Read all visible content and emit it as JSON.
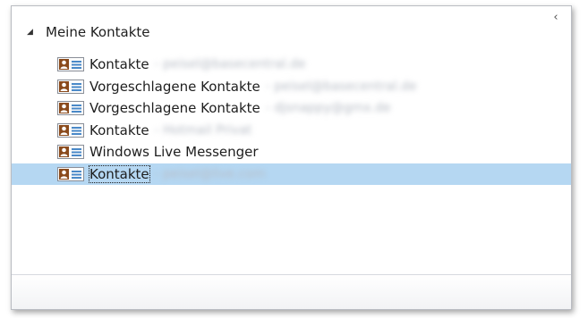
{
  "pane": {
    "collapse_glyph": "‹",
    "group": {
      "expand_glyph": "◢",
      "label": "Meine Kontakte"
    },
    "items": [
      {
        "label": "Kontakte",
        "account": "- peisel@basecentral.de",
        "selected": false
      },
      {
        "label": "Vorgeschlagene Kontakte",
        "account": "- peisel@basecentral.de",
        "selected": false
      },
      {
        "label": "Vorgeschlagene Kontakte",
        "account": "- djsnappy@gmx.de",
        "selected": false
      },
      {
        "label": "Kontakte",
        "account": "- Hotmail Privat",
        "selected": false
      },
      {
        "label": "Windows Live Messenger",
        "account": "",
        "selected": false
      },
      {
        "label": "Kontakte",
        "account": "- peisel@live.com",
        "selected": true
      }
    ],
    "icon_name": "contact-card-icon",
    "colors": {
      "selection": "#b5d7f2",
      "icon_brown": "#8a4a1c",
      "icon_blue": "#4a89c8"
    }
  }
}
